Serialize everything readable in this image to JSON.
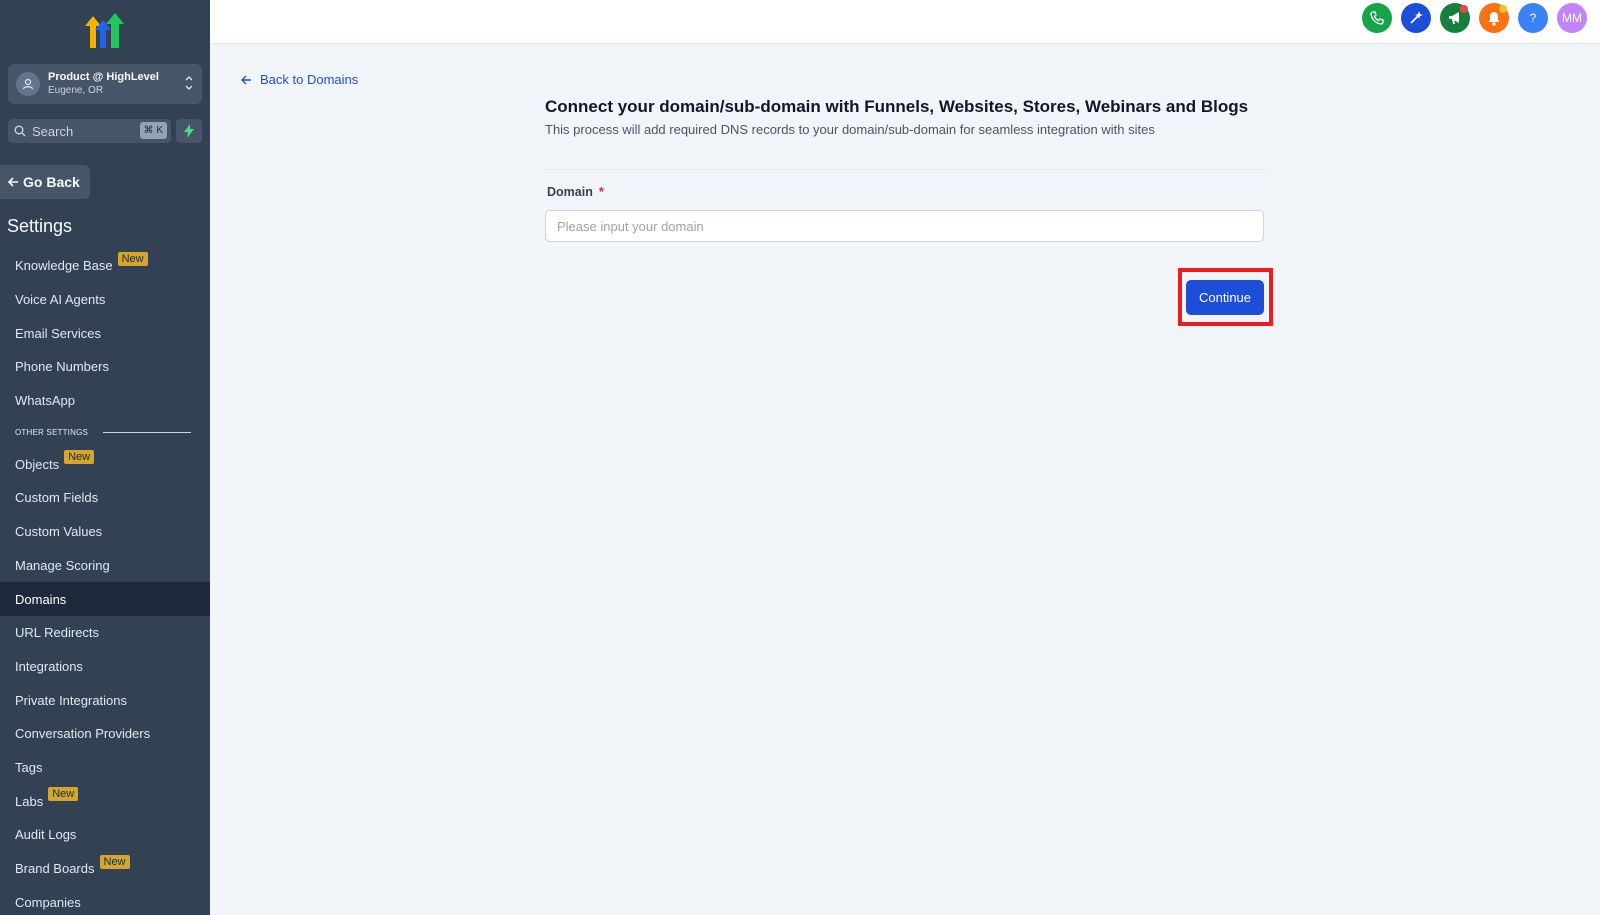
{
  "sidebar": {
    "account": {
      "name": "Product @ HighLevel",
      "location": "Eugene, OR"
    },
    "search": {
      "label": "Search",
      "shortcut": "⌘ K"
    },
    "go_back": "Go Back",
    "settings_title": "Settings",
    "badge_text": "New",
    "section_label": "OTHER SETTINGS",
    "items_top": [
      {
        "label": "Knowledge Base",
        "badge": true
      },
      {
        "label": "Voice AI Agents",
        "badge": false
      },
      {
        "label": "Email Services",
        "badge": false
      },
      {
        "label": "Phone Numbers",
        "badge": false
      },
      {
        "label": "WhatsApp",
        "badge": false
      }
    ],
    "items_other": [
      {
        "label": "Objects",
        "badge": true
      },
      {
        "label": "Custom Fields",
        "badge": false
      },
      {
        "label": "Custom Values",
        "badge": false
      },
      {
        "label": "Manage Scoring",
        "badge": false
      },
      {
        "label": "Domains",
        "badge": false,
        "active": true
      },
      {
        "label": "URL Redirects",
        "badge": false
      },
      {
        "label": "Integrations",
        "badge": false
      },
      {
        "label": "Private Integrations",
        "badge": false
      },
      {
        "label": "Conversation Providers",
        "badge": false
      },
      {
        "label": "Tags",
        "badge": false
      },
      {
        "label": "Labs",
        "badge": true
      },
      {
        "label": "Audit Logs",
        "badge": false
      },
      {
        "label": "Brand Boards",
        "badge": true
      },
      {
        "label": "Companies",
        "badge": false
      }
    ]
  },
  "topbar": {
    "help_label": "?",
    "avatar_initials": "MM",
    "colors": {
      "phone": "#16a34a",
      "ai": "#1d4ed8",
      "announce": "#15803d",
      "notifications": "#f97316",
      "help": "#3b82f6",
      "avatar": "#c084fc"
    }
  },
  "main": {
    "back_link": "Back to Domains",
    "title": "Connect your domain/sub-domain with Funnels, Websites, Stores, Webinars and Blogs",
    "subtitle": "This process will add required DNS records to your domain/sub-domain for seamless integration with sites",
    "domain_label": "Domain",
    "required_mark": "*",
    "domain_value": "",
    "domain_placeholder": "Please input your domain",
    "continue_label": "Continue"
  }
}
